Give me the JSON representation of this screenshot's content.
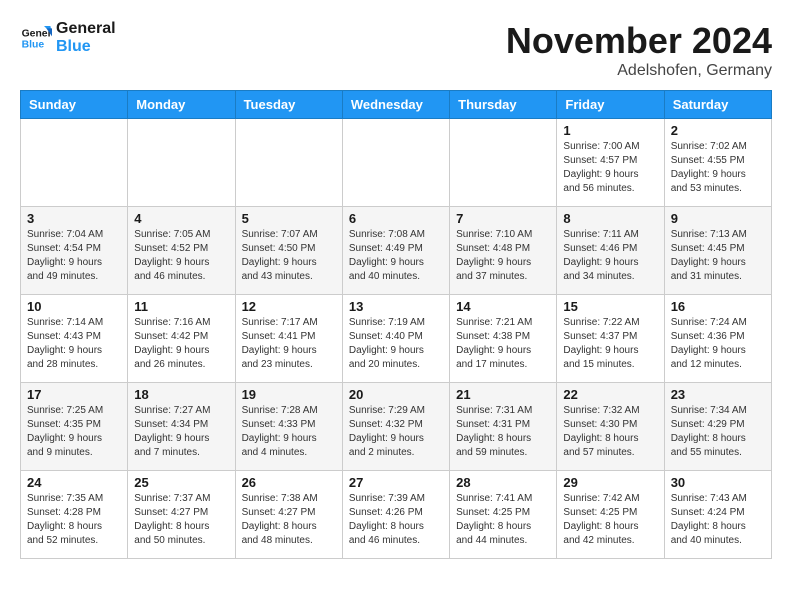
{
  "header": {
    "logo_line1": "General",
    "logo_line2": "Blue",
    "month": "November 2024",
    "location": "Adelshofen, Germany"
  },
  "weekdays": [
    "Sunday",
    "Monday",
    "Tuesday",
    "Wednesday",
    "Thursday",
    "Friday",
    "Saturday"
  ],
  "weeks": [
    [
      {
        "day": "",
        "info": ""
      },
      {
        "day": "",
        "info": ""
      },
      {
        "day": "",
        "info": ""
      },
      {
        "day": "",
        "info": ""
      },
      {
        "day": "",
        "info": ""
      },
      {
        "day": "1",
        "info": "Sunrise: 7:00 AM\nSunset: 4:57 PM\nDaylight: 9 hours\nand 56 minutes."
      },
      {
        "day": "2",
        "info": "Sunrise: 7:02 AM\nSunset: 4:55 PM\nDaylight: 9 hours\nand 53 minutes."
      }
    ],
    [
      {
        "day": "3",
        "info": "Sunrise: 7:04 AM\nSunset: 4:54 PM\nDaylight: 9 hours\nand 49 minutes."
      },
      {
        "day": "4",
        "info": "Sunrise: 7:05 AM\nSunset: 4:52 PM\nDaylight: 9 hours\nand 46 minutes."
      },
      {
        "day": "5",
        "info": "Sunrise: 7:07 AM\nSunset: 4:50 PM\nDaylight: 9 hours\nand 43 minutes."
      },
      {
        "day": "6",
        "info": "Sunrise: 7:08 AM\nSunset: 4:49 PM\nDaylight: 9 hours\nand 40 minutes."
      },
      {
        "day": "7",
        "info": "Sunrise: 7:10 AM\nSunset: 4:48 PM\nDaylight: 9 hours\nand 37 minutes."
      },
      {
        "day": "8",
        "info": "Sunrise: 7:11 AM\nSunset: 4:46 PM\nDaylight: 9 hours\nand 34 minutes."
      },
      {
        "day": "9",
        "info": "Sunrise: 7:13 AM\nSunset: 4:45 PM\nDaylight: 9 hours\nand 31 minutes."
      }
    ],
    [
      {
        "day": "10",
        "info": "Sunrise: 7:14 AM\nSunset: 4:43 PM\nDaylight: 9 hours\nand 28 minutes."
      },
      {
        "day": "11",
        "info": "Sunrise: 7:16 AM\nSunset: 4:42 PM\nDaylight: 9 hours\nand 26 minutes."
      },
      {
        "day": "12",
        "info": "Sunrise: 7:17 AM\nSunset: 4:41 PM\nDaylight: 9 hours\nand 23 minutes."
      },
      {
        "day": "13",
        "info": "Sunrise: 7:19 AM\nSunset: 4:40 PM\nDaylight: 9 hours\nand 20 minutes."
      },
      {
        "day": "14",
        "info": "Sunrise: 7:21 AM\nSunset: 4:38 PM\nDaylight: 9 hours\nand 17 minutes."
      },
      {
        "day": "15",
        "info": "Sunrise: 7:22 AM\nSunset: 4:37 PM\nDaylight: 9 hours\nand 15 minutes."
      },
      {
        "day": "16",
        "info": "Sunrise: 7:24 AM\nSunset: 4:36 PM\nDaylight: 9 hours\nand 12 minutes."
      }
    ],
    [
      {
        "day": "17",
        "info": "Sunrise: 7:25 AM\nSunset: 4:35 PM\nDaylight: 9 hours\nand 9 minutes."
      },
      {
        "day": "18",
        "info": "Sunrise: 7:27 AM\nSunset: 4:34 PM\nDaylight: 9 hours\nand 7 minutes."
      },
      {
        "day": "19",
        "info": "Sunrise: 7:28 AM\nSunset: 4:33 PM\nDaylight: 9 hours\nand 4 minutes."
      },
      {
        "day": "20",
        "info": "Sunrise: 7:29 AM\nSunset: 4:32 PM\nDaylight: 9 hours\nand 2 minutes."
      },
      {
        "day": "21",
        "info": "Sunrise: 7:31 AM\nSunset: 4:31 PM\nDaylight: 8 hours\nand 59 minutes."
      },
      {
        "day": "22",
        "info": "Sunrise: 7:32 AM\nSunset: 4:30 PM\nDaylight: 8 hours\nand 57 minutes."
      },
      {
        "day": "23",
        "info": "Sunrise: 7:34 AM\nSunset: 4:29 PM\nDaylight: 8 hours\nand 55 minutes."
      }
    ],
    [
      {
        "day": "24",
        "info": "Sunrise: 7:35 AM\nSunset: 4:28 PM\nDaylight: 8 hours\nand 52 minutes."
      },
      {
        "day": "25",
        "info": "Sunrise: 7:37 AM\nSunset: 4:27 PM\nDaylight: 8 hours\nand 50 minutes."
      },
      {
        "day": "26",
        "info": "Sunrise: 7:38 AM\nSunset: 4:27 PM\nDaylight: 8 hours\nand 48 minutes."
      },
      {
        "day": "27",
        "info": "Sunrise: 7:39 AM\nSunset: 4:26 PM\nDaylight: 8 hours\nand 46 minutes."
      },
      {
        "day": "28",
        "info": "Sunrise: 7:41 AM\nSunset: 4:25 PM\nDaylight: 8 hours\nand 44 minutes."
      },
      {
        "day": "29",
        "info": "Sunrise: 7:42 AM\nSunset: 4:25 PM\nDaylight: 8 hours\nand 42 minutes."
      },
      {
        "day": "30",
        "info": "Sunrise: 7:43 AM\nSunset: 4:24 PM\nDaylight: 8 hours\nand 40 minutes."
      }
    ]
  ]
}
